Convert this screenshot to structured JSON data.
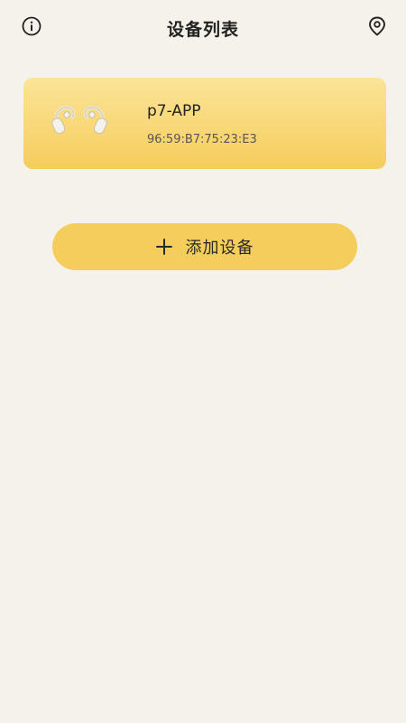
{
  "header": {
    "title": "设备列表",
    "left_icon": "info-icon",
    "right_icon": "location-pin-icon"
  },
  "devices": [
    {
      "name": "p7-APP",
      "mac": "96:59:B7:75:23:E3",
      "image": "earbuds-icon"
    }
  ],
  "add_button": {
    "label": "添加设备",
    "icon": "plus-icon"
  },
  "colors": {
    "background": "#f5f2ec",
    "accent": "#f4cd5c",
    "card_top": "#fbe498",
    "card_bottom": "#f6cd5c"
  }
}
